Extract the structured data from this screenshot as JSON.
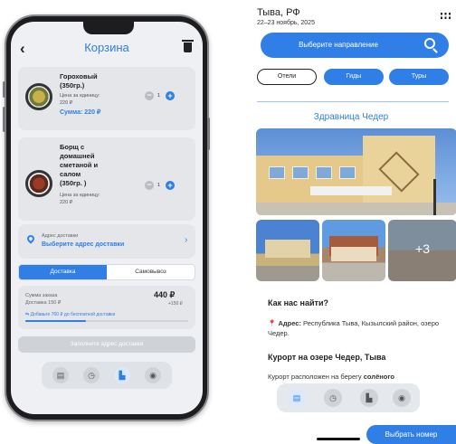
{
  "cart": {
    "title": "Корзина",
    "items": [
      {
        "name_lines": [
          "Гороховый",
          "(350гр.)"
        ],
        "unit_label": "Цена за единицу:",
        "unit_price": "220 ₽",
        "sum": "Сумма: 220 ₽",
        "qty": "1"
      },
      {
        "name_lines": [
          "Борщ с",
          "домашней",
          "сметаной и",
          "салом",
          "(350гр. )"
        ],
        "unit_label": "Цена за единицу:",
        "unit_price": "220 ₽",
        "qty": "1"
      }
    ],
    "address": {
      "caption": "Адрес доставки",
      "value": "Выберите адрес доставки"
    },
    "segments": [
      "Доставка",
      "Самовывоз"
    ],
    "summary": {
      "order_label": "Сумма заказа",
      "delivery_label": "Доставка 150 ₽",
      "total": "440 ₽",
      "fee": "+150 ₽",
      "note": "Добавьте 760 ₽ до бесплатной доставки",
      "progress": 0.37
    },
    "fill_button": "Заполните адрес доставки"
  },
  "tour": {
    "city": "Тыва, РФ",
    "dates": "22–23 ноябрь, 2025",
    "search_text": "Выберите направление",
    "filters": [
      "Отели",
      "Гиды",
      "Туры"
    ],
    "hotel_name": "Здравница Чедер",
    "more_photos": "+3",
    "how_title": "Как нас найти?",
    "address_label": "Адрес:",
    "address_text": "Республика Тыва, Кызылский район, озеро Чедер.",
    "resort_title": "Курорт на озере Чедер, Тыва",
    "resort_text_a": "Курорт расположен на берегу",
    "resort_text_b": "солёного",
    "book_button": "Выбрать номер"
  },
  "colors": {
    "accent": "#2f7fe6",
    "card": "#e4e6ea",
    "screen_bg": "#eef0f3"
  },
  "icons": {
    "tabbar": [
      "list-icon",
      "clock-icon",
      "city-icon",
      "user-icon"
    ]
  }
}
